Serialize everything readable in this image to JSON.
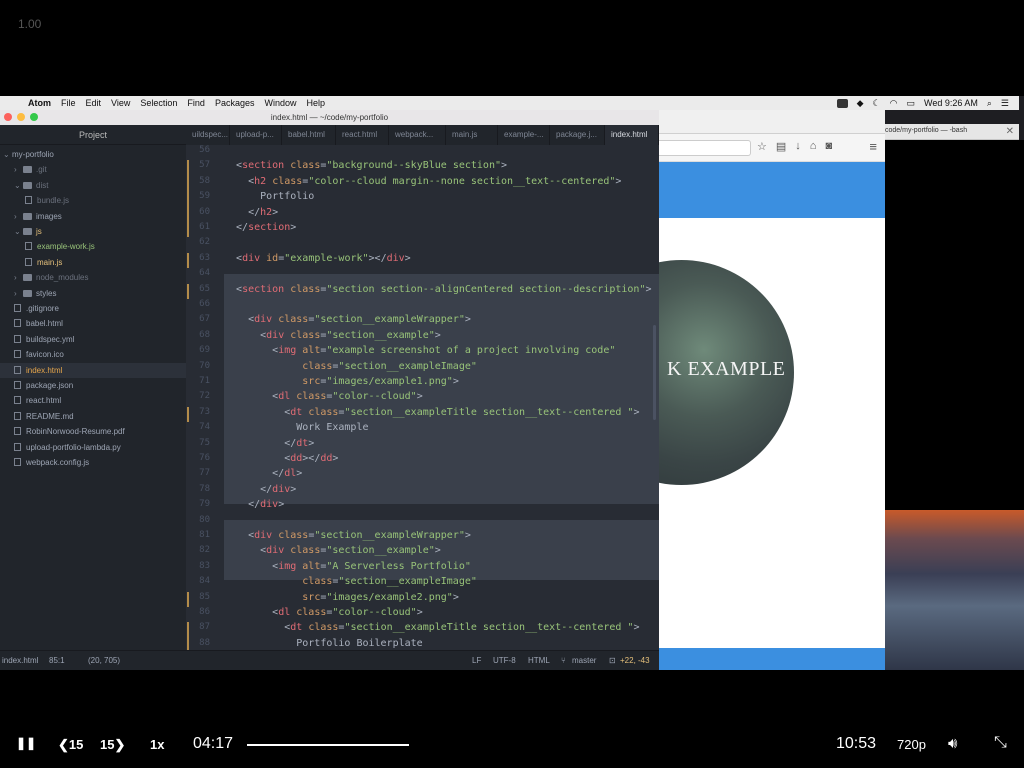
{
  "player": {
    "top_label": "1.00",
    "current_time": "04:17",
    "total_time": "10:53",
    "speed": "1x",
    "quality": "720p",
    "back_label": "15",
    "forward_label": "15",
    "progress": 0.39
  },
  "menubar": {
    "app": "Atom",
    "items": [
      "File",
      "Edit",
      "View",
      "Selection",
      "Find",
      "Packages",
      "Window",
      "Help"
    ],
    "clock": "Wed 9:26 AM"
  },
  "atom": {
    "window_title": "index.html — ~/code/my-portfolio",
    "sidebar_title": "Project",
    "tree": [
      {
        "label": "my-portfolio",
        "kind": "root"
      },
      {
        "label": ".git",
        "kind": "folder-closed"
      },
      {
        "label": "dist",
        "kind": "folder-open"
      },
      {
        "label": "bundle.js",
        "kind": "file"
      },
      {
        "label": "images",
        "kind": "folder-closed"
      },
      {
        "label": "js",
        "kind": "folder-open"
      },
      {
        "label": "example-work.js",
        "kind": "file"
      },
      {
        "label": "main.js",
        "kind": "file"
      },
      {
        "label": "node_modules",
        "kind": "folder-closed"
      },
      {
        "label": "styles",
        "kind": "folder-closed"
      },
      {
        "label": ".gitignore",
        "kind": "file"
      },
      {
        "label": "babel.html",
        "kind": "file"
      },
      {
        "label": "buildspec.yml",
        "kind": "file"
      },
      {
        "label": "favicon.ico",
        "kind": "file"
      },
      {
        "label": "index.html",
        "kind": "file"
      },
      {
        "label": "package.json",
        "kind": "file"
      },
      {
        "label": "react.html",
        "kind": "file"
      },
      {
        "label": "README.md",
        "kind": "file"
      },
      {
        "label": "RobinNorwood-Resume.pdf",
        "kind": "file"
      },
      {
        "label": "upload-portfolio-lambda.py",
        "kind": "file"
      },
      {
        "label": "webpack.config.js",
        "kind": "file"
      }
    ],
    "tabs": [
      "uildspec...",
      "upload-p...",
      "babel.html",
      "react.html",
      "webpack...",
      "main.js",
      "example-...",
      "package.j...",
      "index.html"
    ],
    "line_numbers": [
      "56",
      "57",
      "58",
      "59",
      "60",
      "61",
      "62",
      "63",
      "64",
      "65",
      "66",
      "67",
      "68",
      "69",
      "70",
      "71",
      "72",
      "73",
      "74",
      "75",
      "76",
      "77",
      "78",
      "79",
      "80",
      "81",
      "82",
      "83",
      "84",
      "85",
      "86",
      "87",
      "88"
    ],
    "status": {
      "file": "index.html",
      "cursor": "85:1",
      "selection": "(20, 705)",
      "eol": "LF",
      "encoding": "UTF-8",
      "grammar": "HTML",
      "branch": "master",
      "diff": "+22, -43"
    }
  },
  "firefox": {
    "circle_text": "K EXAMPLE"
  },
  "terminal": {
    "title": "code/my-portfolio — -bash"
  },
  "colors": {
    "editor_bg": "#282c34",
    "sidebar_bg": "#21252b",
    "tag": "#e06c75",
    "attr": "#d19a66",
    "string": "#98c379",
    "portfolio_blue": "#3b8fe0"
  }
}
